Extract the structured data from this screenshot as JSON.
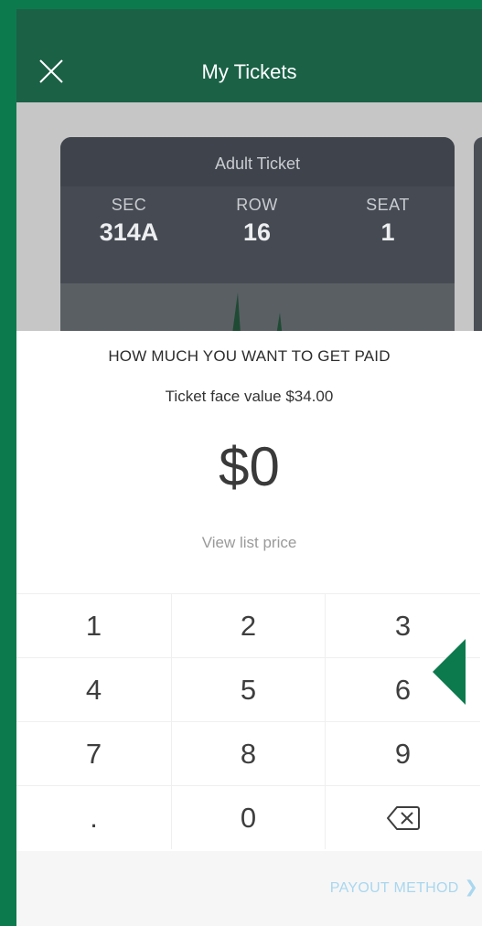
{
  "header": {
    "title": "My Tickets"
  },
  "ticket": {
    "type": "Adult Ticket",
    "columns": [
      {
        "label": "SEC",
        "value": "314A"
      },
      {
        "label": "ROW",
        "value": "16"
      },
      {
        "label": "SEAT",
        "value": "1"
      }
    ]
  },
  "sheet": {
    "heading": "HOW MUCH YOU WANT TO GET PAID",
    "face_value": "Ticket face value $34.00",
    "amount": "$0",
    "view_list_price": "View list price",
    "keys": [
      "1",
      "2",
      "3",
      "4",
      "5",
      "6",
      "7",
      "8",
      "9",
      ".",
      "0"
    ],
    "payout_label": "PAYOUT METHOD",
    "payout_chevron": "❯"
  },
  "colors": {
    "frame": "#0d7a4e",
    "header": "#1a6146",
    "link": "#a9d7ef"
  }
}
